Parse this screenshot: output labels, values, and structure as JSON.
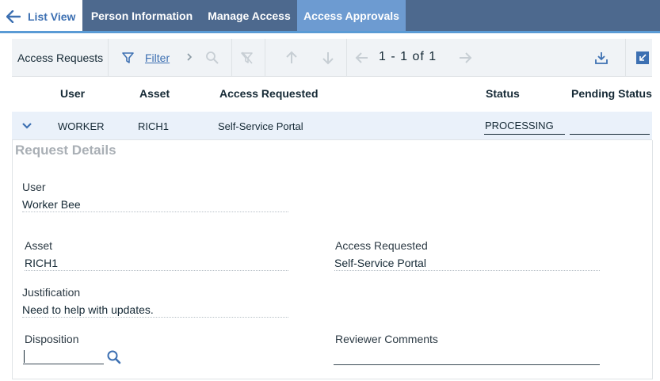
{
  "tabs": {
    "back_label": "List View",
    "person": "Person Information",
    "manage": "Manage Access",
    "approvals": "Access Approvals",
    "active": "approvals"
  },
  "toolbar": {
    "title": "Access Requests",
    "filter_label": "Filter",
    "pager": "1 - 1 of 1"
  },
  "table": {
    "headers": [
      "User",
      "Asset",
      "Access Requested",
      "Status",
      "Pending Status"
    ],
    "row": {
      "user": "WORKER",
      "asset": "RICH1",
      "access_requested": "Self-Service Portal",
      "status": "PROCESSING",
      "pending_status": ""
    }
  },
  "details": {
    "title": "Request Details",
    "user_label": "User",
    "user_value": "Worker Bee",
    "asset_label": "Asset",
    "asset_value": "RICH1",
    "access_label": "Access Requested",
    "access_value": "Self-Service Portal",
    "justification_label": "Justification",
    "justification_value": "Need to help with updates.",
    "disposition_label": "Disposition",
    "disposition_value": "",
    "reviewer_label": "Reviewer Comments",
    "reviewer_value": ""
  },
  "colors": {
    "tabbar": "#4d698e",
    "active_tab": "#6d9bd1",
    "link": "#3d70b2",
    "selected_row": "#eaf1fa"
  }
}
